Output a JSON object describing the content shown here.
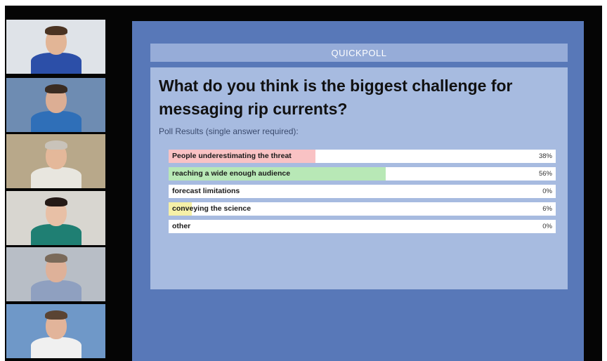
{
  "poll": {
    "header": "QUICKPOLL",
    "question": "What do you think is the biggest challenge for messaging rip currents?",
    "subtitle": "Poll Results (single answer required):",
    "results": [
      {
        "label": "People underestimating the threat",
        "percent_text": "38%",
        "value": 38,
        "color": "#f9c2c4"
      },
      {
        "label": "reaching a wide enough audience",
        "percent_text": "56%",
        "value": 56,
        "color": "#b8e8b6"
      },
      {
        "label": "forecast limitations",
        "percent_text": "0%",
        "value": 0,
        "color": "#c8d4f0"
      },
      {
        "label": "conveying the science",
        "percent_text": "6%",
        "value": 6,
        "color": "#f5f0a8"
      },
      {
        "label": "other",
        "percent_text": "0%",
        "value": 0,
        "color": "#d8d8d8"
      }
    ]
  },
  "participants": [
    {
      "name": "participant-video-1",
      "shirt": "#2c4fa8",
      "bg": "#dfe3e8",
      "skin": "#e2b596",
      "hair": "#4a3322"
    },
    {
      "name": "participant-video-2",
      "shirt": "#2f6fb8",
      "bg": "#6e8cb2",
      "skin": "#dcae94",
      "hair": "#3a2c22"
    },
    {
      "name": "participant-video-3",
      "shirt": "#e8e6df",
      "bg": "#b8a88a",
      "skin": "#e4b89a",
      "hair": "#c9c3ba"
    },
    {
      "name": "participant-video-4",
      "shirt": "#1f7f73",
      "bg": "#d8d6d0",
      "skin": "#e8c0a6",
      "hair": "#241a16"
    },
    {
      "name": "participant-video-5",
      "shirt": "#8fa0c0",
      "bg": "#b8bec6",
      "skin": "#deb199",
      "hair": "#7a6a5a"
    },
    {
      "name": "participant-video-6",
      "shirt": "#f0f0f0",
      "bg": "#6f98c8",
      "skin": "#e2b49a",
      "hair": "#5a4434"
    }
  ]
}
